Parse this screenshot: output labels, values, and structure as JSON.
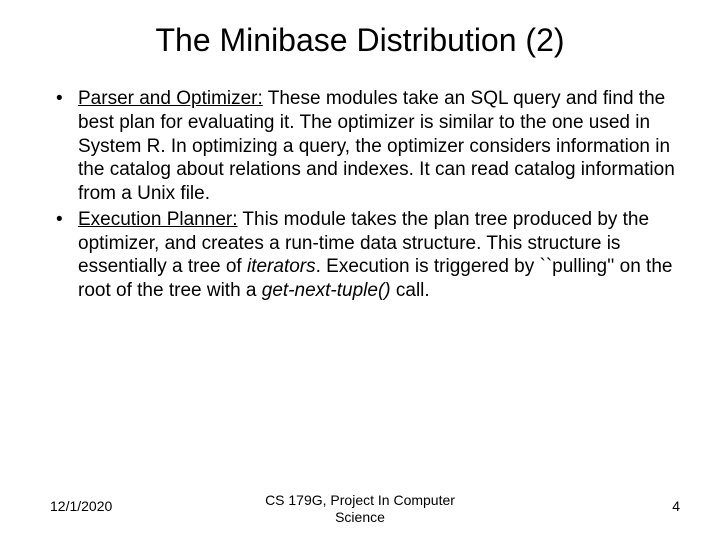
{
  "title": "The Minibase Distribution (2)",
  "bullets": [
    {
      "heading": "Parser and Optimizer:",
      "body_html": " These modules take an SQL query and find the best plan for evaluating it. The optimizer is similar to the one used in System R. In optimizing a query, the optimizer considers information in the catalog about relations and indexes. It can read catalog information from a Unix file."
    },
    {
      "heading": "Execution Planner:",
      "body_pre": " This module takes the plan tree produced by the optimizer, and creates a run-time data structure. This structure is essentially a tree of ",
      "italic1": "iterators",
      "body_mid": ". Execution is triggered by ``pulling'' on the root of the tree with a ",
      "italic2": "get-next-tuple()",
      "body_post": " call."
    }
  ],
  "footer": {
    "date": "12/1/2020",
    "center_line1": "CS 179G, Project In Computer",
    "center_line2": "Science",
    "page": "4"
  }
}
